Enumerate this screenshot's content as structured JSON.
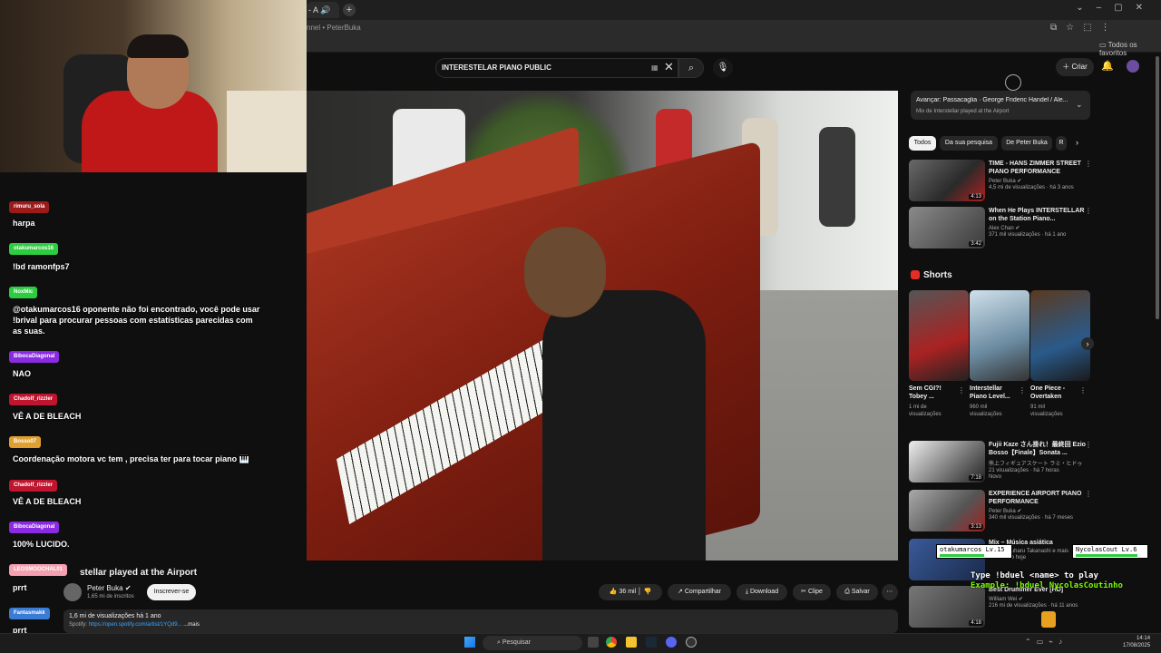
{
  "browser": {
    "tab_title": "- A",
    "url_breadcrumb": "nnel • PeterBuka",
    "bookmarks_label": "Todos os favoritos"
  },
  "header": {
    "search_value": "INTERESTELAR PIANO PUBLIC",
    "kbd": "▦",
    "create_label": "Criar"
  },
  "video": {
    "title": "stellar played at the Airport",
    "channel": "Peter Buka",
    "subscribers": "1,65 mi de inscritos",
    "subscribe_label": "Inscrever-se",
    "likes": "36 mil",
    "share_label": "Compartilhar",
    "download_label": "Download",
    "clip_label": "Clipe",
    "save_label": "Salvar",
    "views_line": "1,6 mi de visualizações  há 1 ano",
    "desc_prefix": "Spotify: ",
    "desc_link": "https://open.spotify.com/artist/1YQd9...",
    "more_label": "...mais"
  },
  "playlist": {
    "title": "Avançar: Passacaglia · George Frideric Handel / Ale...",
    "subtitle": "Mix de Interstellar played at the Airport"
  },
  "chips": [
    "Todos",
    "Da sua pesquisa",
    "De Peter Buka",
    "R"
  ],
  "related": [
    {
      "title": "TIME - HANS ZIMMER STREET PIANO PERFORMANCE",
      "channel": "Peter Buka ✔",
      "meta": "4,5 mi de visualizações · há 3 anos",
      "duration": "4:13"
    },
    {
      "title": "When He Plays INTERSTELLAR on the Station Piano...",
      "channel": "Alex Chan ✔",
      "meta": "371 mil visualizações · há 1 ano",
      "duration": "3:42"
    }
  ],
  "shorts_heading": "Shorts",
  "shorts": [
    {
      "title": "Sem CGI?! Tobey ...",
      "views": "1 mi de visualizações"
    },
    {
      "title": "Interstellar Piano Level...",
      "views": "960 mil visualizações"
    },
    {
      "title": "One Piece - Overtaken",
      "views": "91 mil visualizações"
    }
  ],
  "related2": [
    {
      "title": "Fujii Kaze さん掛れ！最終回 Ezio Bosso【Finale】Sonata ...",
      "channel": "熊上フィギュアスケート ラミ・ヒドゥ",
      "meta": "21 visualizações · há 7 horas",
      "badge": "Novo",
      "duration": "7:18"
    },
    {
      "title": "EXPERIENCE AIRPORT PIANO PERFORMANCE",
      "channel": "Peter Buka ✔",
      "meta": "340 mil visualizações · há 7 meses",
      "duration": "3:13"
    },
    {
      "title": "Mix – Música asiática",
      "channel": "OST, Yasuharu Takanashi e mais",
      "meta": "Atualizado hoje",
      "duration": ""
    },
    {
      "title": "Best Drummer Ever [HD]",
      "channel": "William Wei ✔",
      "meta": "216 mi de visualizações · há 11 anos",
      "duration": "4:18"
    }
  ],
  "chat": [
    {
      "user": "rimuru_sola",
      "message": "harpa",
      "color": "#9b1b1b"
    },
    {
      "user": "otakumarcos16",
      "message": "!bd ramonfps7",
      "color": "#2ecc40"
    },
    {
      "user": "NoxMic",
      "message": "@otakumarcos16 oponente não foi encontrado, você pode usar !brival para procurar pessoas com estatísticas parecidas com as suas.",
      "color": "#2ecc40"
    },
    {
      "user": "BibocaDiagonal",
      "message": "NAO",
      "color": "#8a2be2"
    },
    {
      "user": "Chadolf_rizzler",
      "message": "VÊ A DE BLEACH",
      "color": "#c0152f"
    },
    {
      "user": "Bosso07",
      "message": "Coordenação motora vc tem , precisa ter para tocar piano 🎹",
      "color": "#e0a030"
    },
    {
      "user": "Chadolf_rizzler",
      "message": "VÊ A DE BLEACH",
      "color": "#c0152f"
    },
    {
      "user": "BibocaDiagonal",
      "message": "100% LUCIDO.",
      "color": "#8a2be2"
    },
    {
      "user": "LEOSMOOCHAL01",
      "message": "prrt",
      "color": "#f4a0b0"
    },
    {
      "user": "Fantasmakk",
      "message": "prrt",
      "color": "#3a7bd5"
    }
  ],
  "duel": {
    "player1": "otakumarcos Lv.15",
    "player2": "NycolasCout Lv.6",
    "hp1": 0.65,
    "hp2": 0.9,
    "line1": "Type !bduel <name> to play",
    "line2": "Example: !bduel NycolasCoutinho"
  },
  "taskbar": {
    "search_label": "Pesquisar",
    "time": "14:14",
    "date": "17/08/2025"
  }
}
